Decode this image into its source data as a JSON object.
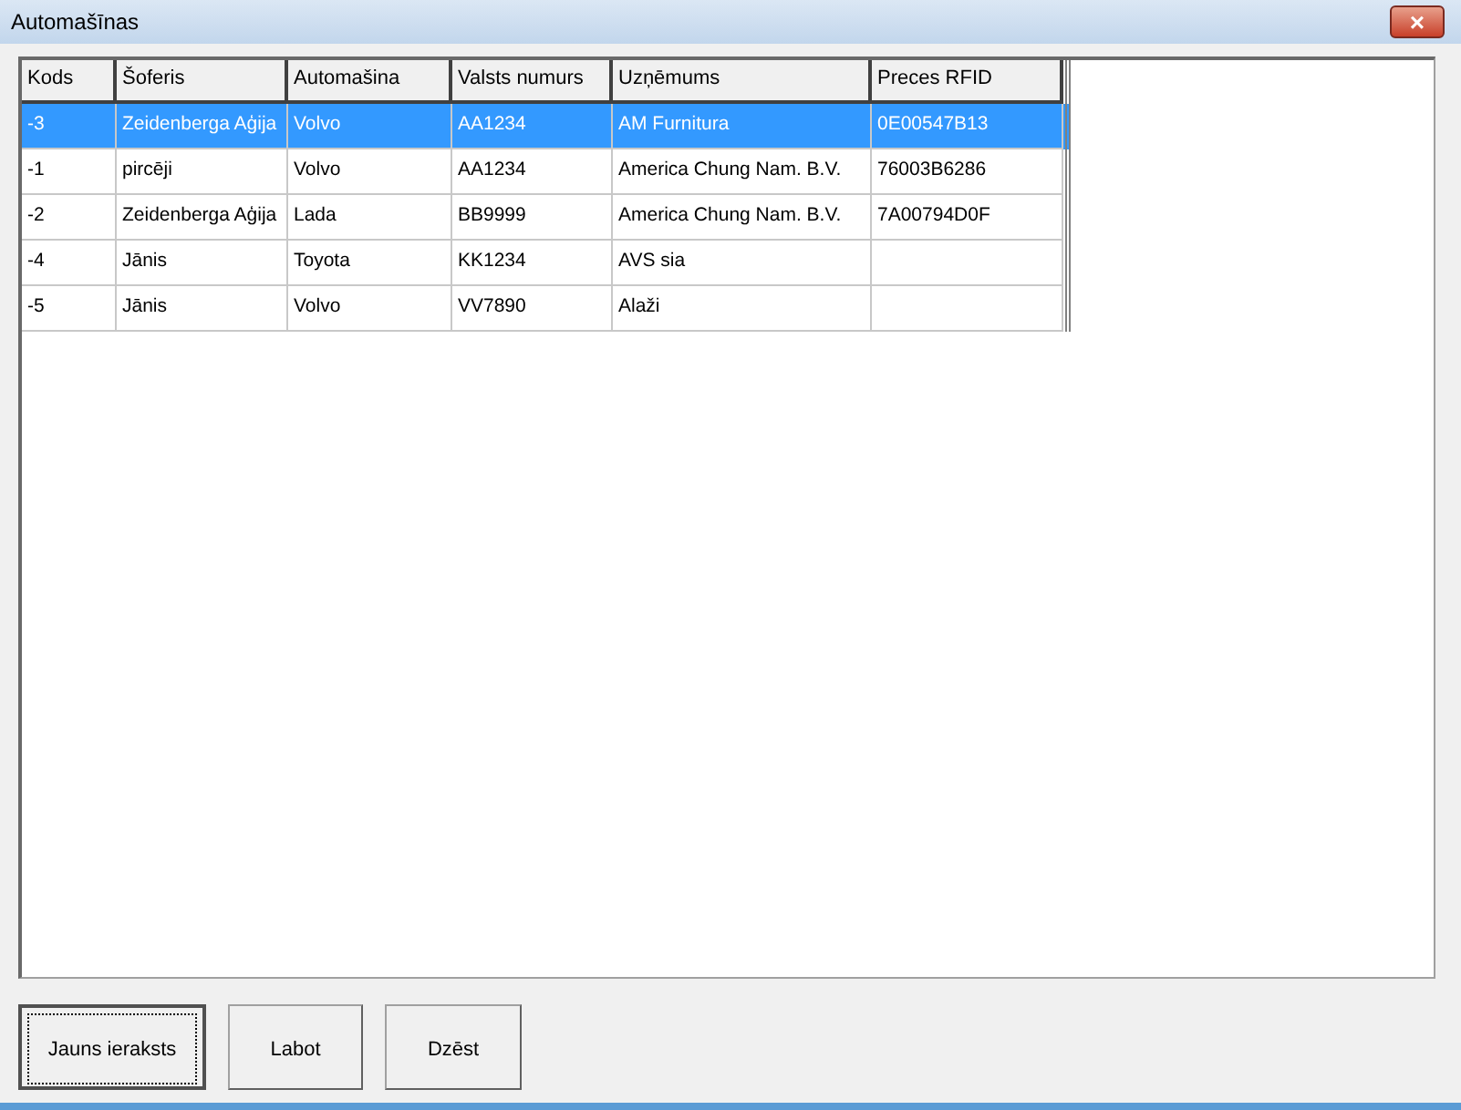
{
  "window": {
    "title": "Automašīnas",
    "close_label": "×"
  },
  "table": {
    "columns": [
      "Kods",
      "Šoferis",
      "Automašina",
      "Valsts numurs",
      "Uzņēmums",
      "Preces RFID"
    ],
    "rows": [
      {
        "selected": true,
        "cells": [
          "-3",
          "Zeidenberga Aģija",
          "Volvo",
          "AA1234",
          "AM Furnitura",
          "0E00547B13"
        ]
      },
      {
        "selected": false,
        "cells": [
          "-1",
          "pircēji",
          "Volvo",
          "AA1234",
          "America Chung Nam. B.V.",
          "76003B6286"
        ]
      },
      {
        "selected": false,
        "cells": [
          "-2",
          "Zeidenberga Aģija",
          "Lada",
          "BB9999",
          "America Chung Nam. B.V.",
          "7A00794D0F"
        ]
      },
      {
        "selected": false,
        "cells": [
          "-4",
          "Jānis",
          "Toyota",
          "KK1234",
          "AVS sia",
          ""
        ]
      },
      {
        "selected": false,
        "cells": [
          "-5",
          "Jānis",
          "Volvo",
          "VV7890",
          "Alaži",
          ""
        ]
      }
    ]
  },
  "buttons": [
    {
      "label": "Jauns ieraksts",
      "focused": true
    },
    {
      "label": "Labot",
      "focused": false
    },
    {
      "label": "Dzēst",
      "focused": false
    }
  ]
}
